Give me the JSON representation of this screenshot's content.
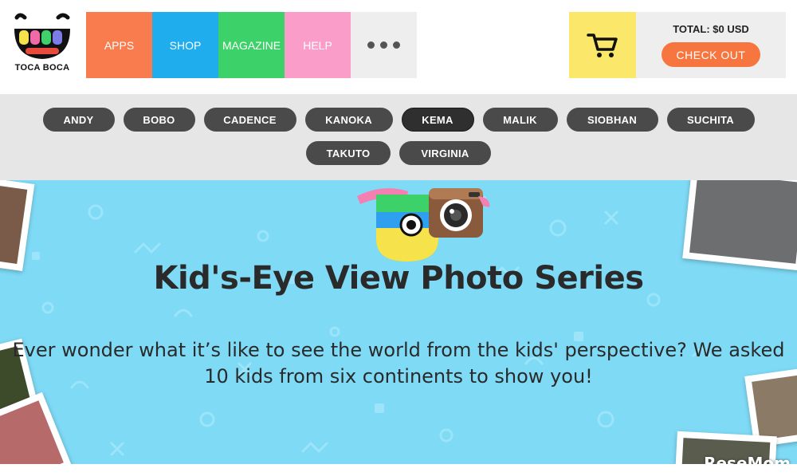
{
  "brand": {
    "name": "TOCA BOCA"
  },
  "nav": {
    "items": [
      {
        "label": "APPS",
        "color": "#f97c4f"
      },
      {
        "label": "SHOP",
        "color": "#1fadee"
      },
      {
        "label": "MAGAZINE",
        "color": "#3dd16a"
      },
      {
        "label": "HELP",
        "color": "#fa9ec9"
      }
    ],
    "more_icon": "more-dots-icon"
  },
  "cart": {
    "icon": "shopping-cart-icon",
    "total_label": "TOTAL: $0 USD",
    "checkout_label": "CHECK OUT"
  },
  "kids": {
    "row1": [
      "ANDY",
      "BOBO",
      "CADENCE",
      "KANOKA",
      "KEMA",
      "MALIK",
      "SIOBHAN",
      "SUCHITA"
    ],
    "row2": [
      "TAKUTO",
      "VIRGINIA"
    ],
    "active": "KEMA"
  },
  "hero": {
    "title": "Kid's-Eye View Photo Series",
    "subtitle_line1": "Ever wonder what it’s like to see the world from the kids' perspective? We asked",
    "subtitle_line2": "10 kids from six continents to show you!",
    "background_color": "#7fdaf6"
  },
  "watermark": "ReseMom"
}
